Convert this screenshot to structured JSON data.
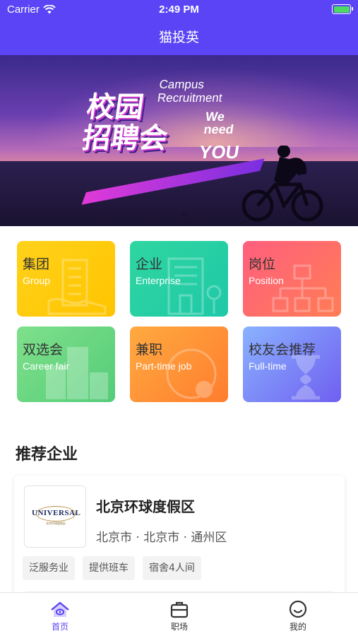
{
  "status_bar": {
    "carrier": "Carrier",
    "time": "2:49 PM",
    "battery_level": 1.0
  },
  "nav": {
    "title": "猫投英"
  },
  "banner": {
    "cn_line1": "校园",
    "cn_line2": "招聘会",
    "en_line1": "Campus",
    "en_line2": "Recruitment",
    "we": "We",
    "need": "need",
    "you": "YOU",
    "slide_count": 1,
    "active_slide": 1
  },
  "categories": [
    {
      "title": "集团",
      "subtitle": "Group",
      "colors": [
        "#ffd21a",
        "#ffc400"
      ],
      "icon": "building-icon"
    },
    {
      "title": "企业",
      "subtitle": "Enterprise",
      "colors": [
        "#2fd6a0",
        "#1fc8a8"
      ],
      "icon": "office-icon"
    },
    {
      "title": "岗位",
      "subtitle": "Position",
      "colors": [
        "#ff5f7e",
        "#ff7d55"
      ],
      "icon": "org-chart-icon"
    },
    {
      "title": "双选会",
      "subtitle": "Career fair",
      "colors": [
        "#7fe08a",
        "#55cc7a"
      ],
      "icon": "city-icon"
    },
    {
      "title": "兼职",
      "subtitle": "Part-time job",
      "colors": [
        "#ffaa40",
        "#ff7d2e"
      ],
      "icon": "coin-icon"
    },
    {
      "title": "校友会推荐",
      "subtitle": "Full-time",
      "colors": [
        "#8ab2ff",
        "#6f5ff0"
      ],
      "icon": "hourglass-icon"
    }
  ],
  "section": {
    "title": "推荐企业"
  },
  "company": {
    "logo_text": "UNIVERSAL",
    "logo_sub": "北京环球度假区",
    "name": "北京环球度假区",
    "location": "北京市 · 北京市 · 通州区",
    "tags": [
      "泛服务业",
      "提供班车",
      "宿舍4人间"
    ]
  },
  "tabbar": {
    "accent": "#5a44f5",
    "items": [
      {
        "label": "首页",
        "icon": "home-icon",
        "active": true
      },
      {
        "label": "职场",
        "icon": "briefcase-icon",
        "active": false
      },
      {
        "label": "我的",
        "icon": "smile-icon",
        "active": false
      }
    ]
  }
}
